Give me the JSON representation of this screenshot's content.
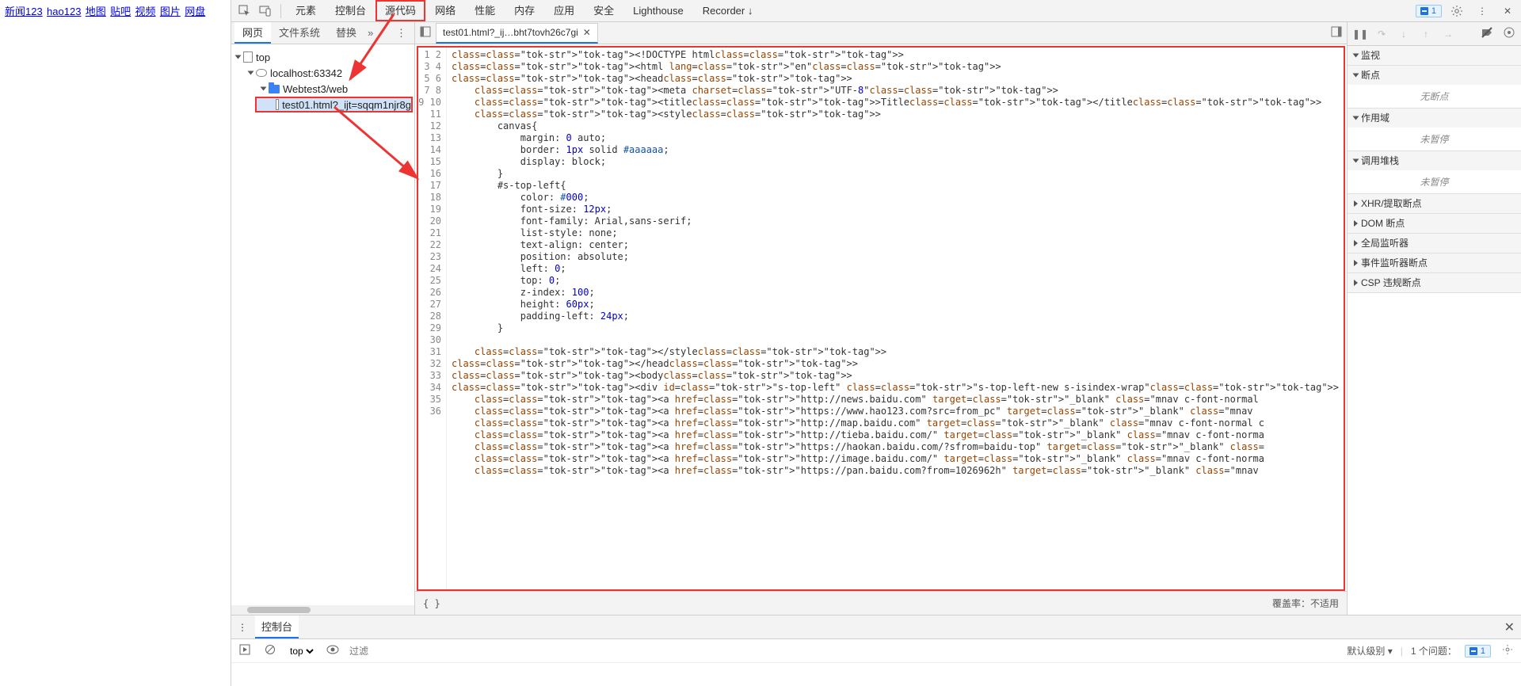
{
  "page_links": [
    "新闻123",
    "hao123",
    "地图",
    "贴吧",
    "视频",
    "图片",
    "网盘"
  ],
  "devtools_tabs": [
    "元素",
    "控制台",
    "源代码",
    "网络",
    "性能",
    "内存",
    "应用",
    "安全",
    "Lighthouse",
    "Recorder ↓"
  ],
  "active_devtools_tab": "源代码",
  "issue_chip_count": "1",
  "nav_tabs": {
    "page": "网页",
    "fs": "文件系统",
    "overrides": "替换",
    "more": "»"
  },
  "file_tree": {
    "top": "top",
    "host": "localhost:63342",
    "folder": "Webtest3/web",
    "file": "test01.html?_ijt=sqqm1njr8g"
  },
  "open_file_tab": "test01.html?_ij…bht7tovh26c7gi",
  "coverage_label": "覆盖率：不适用",
  "debug_panel": {
    "watch": "监视",
    "breakpoints": "断点",
    "breakpoints_empty": "无断点",
    "scope": "作用域",
    "scope_empty": "未暂停",
    "callstack": "调用堆栈",
    "callstack_empty": "未暂停",
    "xhr": "XHR/提取断点",
    "dom": "DOM 断点",
    "global": "全局监听器",
    "event": "事件监听器断点",
    "csp": "CSP 违规断点"
  },
  "drawer": {
    "console_tab": "控制台",
    "context": "top",
    "filter_placeholder": "过滤",
    "level": "默认级别",
    "issues": "1 个问题："
  },
  "source_lines": [
    "<!DOCTYPE html>",
    "<html lang=\"en\">",
    "<head>",
    "    <meta charset=\"UTF-8\">",
    "    <title>Title</title>",
    "    <style>",
    "        canvas{",
    "            margin: 0 auto;",
    "            border: 1px solid #aaaaaa;",
    "            display: block;",
    "        }",
    "        #s-top-left{",
    "            color: #000;",
    "            font-size: 12px;",
    "            font-family: Arial,sans-serif;",
    "            list-style: none;",
    "            text-align: center;",
    "            position: absolute;",
    "            left: 0;",
    "            top: 0;",
    "            z-index: 100;",
    "            height: 60px;",
    "            padding-left: 24px;",
    "        }",
    "",
    "    </style>",
    "</head>",
    "<body>",
    "<div id=\"s-top-left\" class=\"s-top-left-new s-isindex-wrap\">",
    "    <a href=\"http://news.baidu.com\" target=\"_blank\" class=\"mnav c-font-normal",
    "    <a href=\"https://www.hao123.com?src=from_pc\" target=\"_blank\" class=\"mnav",
    "    <a href=\"http://map.baidu.com\" target=\"_blank\" class=\"mnav c-font-normal c",
    "    <a href=\"http://tieba.baidu.com/\" target=\"_blank\" class=\"mnav c-font-norma",
    "    <a href=\"https://haokan.baidu.com/?sfrom=baidu-top\" target=\"_blank\" class=",
    "    <a href=\"http://image.baidu.com/\" target=\"_blank\" class=\"mnav c-font-norma",
    "    <a href=\"https://pan.baidu.com?from=1026962h\" target=\"_blank\" class=\"mnav "
  ]
}
